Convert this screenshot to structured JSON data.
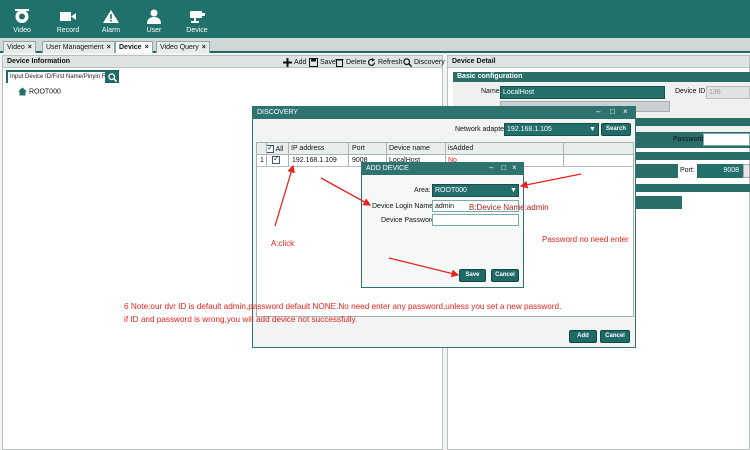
{
  "toolbar": {
    "items": [
      {
        "label": "Video"
      },
      {
        "label": "Record"
      },
      {
        "label": "Alarm"
      },
      {
        "label": "User"
      },
      {
        "label": "Device"
      }
    ]
  },
  "tabs": [
    {
      "label": "Video"
    },
    {
      "label": "User Management"
    },
    {
      "label": "Device"
    },
    {
      "label": "Video Query"
    }
  ],
  "device_info": {
    "title": "Device Information",
    "actions": {
      "add": "Add",
      "save": "Save",
      "delete": "Delete",
      "refresh": "Refresh",
      "discovery": "Discovery"
    },
    "search_placeholder": "Input Device ID/First Name/Pinyin F",
    "tree_root": "ROOT000"
  },
  "device_detail": {
    "title": "Device Detail",
    "section": "Basic configuration",
    "name_label": "Name:",
    "name_value": "LocalHost",
    "device_id_label": "Device ID:",
    "device_id_value": "136",
    "password_label": "Password:",
    "port_label": "Port:",
    "port_value": "9008"
  },
  "discovery": {
    "title": "DISCOVERY",
    "network_label": "Network adapter",
    "network_value": "192.168.1.105",
    "search_button": "Search",
    "columns": {
      "all": "All",
      "ip": "IP address",
      "port": "Port",
      "name": "Device name",
      "added": "isAdded"
    },
    "row": {
      "num": "1",
      "ip": "192.168.1.109",
      "port": "9008",
      "name": "LocalHost",
      "added": "No"
    },
    "add_button": "Add",
    "cancel_button": "Cancel"
  },
  "add_device": {
    "title": "ADD DEVICE",
    "area_label": "Area:",
    "area_value": "ROOT000",
    "login_label": "Device Login Name:",
    "login_value": "admin",
    "password_label": "Device Password:",
    "save_button": "Save",
    "cancel_button": "Cancel"
  },
  "annotations": {
    "click": "A:click",
    "login": "B:Device Name:admin",
    "password": "Password no need enter",
    "note_line1": "6 Note:our dvr ID is default admin,password default NONE.No need enter any password,unless you set a new password.",
    "note_line2": "if ID and password is wrong,you will add device not successfully."
  },
  "colors": {
    "toolbar": "#20706c",
    "dialog_title": "#2e7370",
    "button": "#1f6a66",
    "annotation": "#e8231f"
  }
}
